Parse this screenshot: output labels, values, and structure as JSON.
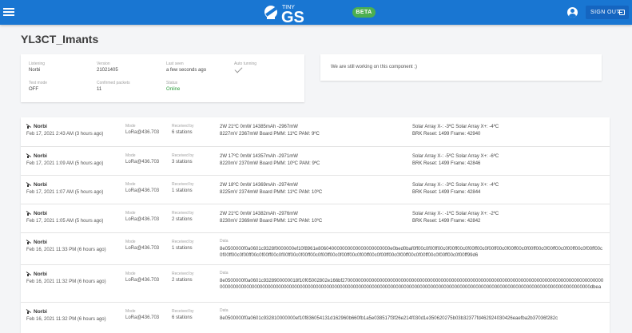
{
  "header": {
    "logo_text_top": "TINY",
    "logo_text_main": "GS",
    "beta": "BETA",
    "signout": "SIGN OUT"
  },
  "station": {
    "name": "YL3CT_Imants",
    "fields": [
      {
        "label": "Listening",
        "value": "Norbi"
      },
      {
        "label": "Version",
        "value": "21021405"
      },
      {
        "label": "Last seen",
        "value": "a few seconds ago"
      },
      {
        "label": "Auto tunning",
        "value": ""
      },
      {
        "label": "Test mode",
        "value": "OFF"
      },
      {
        "label": "Confirmed packets",
        "value": "11"
      },
      {
        "label": "Status",
        "value": "Online"
      }
    ],
    "wip": "We are still working on this component ;)"
  },
  "packets": [
    {
      "sat": "Norbi",
      "date": "Feb 17, 2021 2:43 AM (3 hours ago)",
      "mode": "LoRa@436.703",
      "received": "6 stations",
      "t1": "2W  21ºC  0mW  14385mAh  -2967mW",
      "t2": "8227mV  2367mW  Board PMM: 11ºC PAM: 9ºC",
      "t3": "Solar Array X-: -3ºC Solar Array X+: -4ºC",
      "t4": "BRK Reset: 1499 Frame: 42940"
    },
    {
      "sat": "Norbi",
      "date": "Feb 17, 2021 1:09 AM (5 hours ago)",
      "mode": "LoRa@436.703",
      "received": "3 stations",
      "t1": "2W  17ºC  0mW  14357mAh  -2971mW",
      "t2": "8220mV  2370mW  Board PMM: 10ºC PAM: 9ºC",
      "t3": "Solar Array X-: -5ºC Solar Array X+: -6ºC",
      "t4": "BRK Reset: 1499 Frame: 42846"
    },
    {
      "sat": "Norbi",
      "date": "Feb 17, 2021 1:07 AM (5 hours ago)",
      "mode": "LoRa@436.703",
      "received": "1 stations",
      "t1": "2W  18ºC  0mW  14369mAh  -2974mW",
      "t2": "8225mV  2374mW  Board PMM: 11ºC PAM: 10ºC",
      "t3": "Solar Array X-: -3ºC Solar Array X+: -4ºC",
      "t4": "BRK Reset: 1499 Frame: 42844"
    },
    {
      "sat": "Norbi",
      "date": "Feb 17, 2021 1:05 AM (5 hours ago)",
      "mode": "LoRa@436.703",
      "received": "2 stations",
      "t1": "2W  21ºC  0mW  14382mAh  -2976mW",
      "t2": "8230mV  2369mW  Board PMM: 11ºC PAM: 10ºC",
      "t3": "Solar Array X-: -1ºC Solar Array X+: -2ºC",
      "t4": "BRK Reset: 1499 Frame: 42842"
    },
    {
      "sat": "Norbi",
      "date": "Feb 16, 2021 11:33 PM (6 hours ago)",
      "mode": "LoRa@436.703",
      "received": "1 stations",
      "data": "8e0500000f0a0601c9328f0000000ef10f8961e806040000000000000000000000e0bed0baf0ff00c0f00ff00c0f00ff00c0f00ff00c0f00ff00c0f00ff00c0f00ff00c0f00ff00c0f00ff00c0f00ff00c0f00ff00c0f00ff00c0f00ff00c0f00ff00c0f00ff00c0f00ff00c0f00ff00c0f00ff00c0f00ff00c0f00ff00c0f00ff00c0f00ff00c0f00ff99d6"
    },
    {
      "sat": "Norbi",
      "date": "Feb 16, 2021 11:32 PM (6 hours ago)",
      "mode": "LoRa@436.703",
      "received": "2 stations",
      "data": "8e0500000f0a0601c9328900000018f10f05002802e166bf270000000000000000000000000000000000000000000000000000000000000000000000000000000000000000000000000000000000000000000000000000000000000000000000000000000000000000000000000000000000000000000000000000000000000000000000000000000000000000000dbea"
    },
    {
      "sat": "Norbi",
      "date": "Feb 16, 2021 11:32 PM (6 hours ago)",
      "mode": "LoRa@436.703",
      "received": "6 stations",
      "data": "8e0500000f0a0601c932810000000ef10f836054131d162960b660fb1a5e038517f3f26e214f030d1e350620275b03b32377fd462924030426eaefba2b37036f282c"
    }
  ],
  "labels": {
    "mode": "Mode",
    "received": "Received by",
    "data": "Data"
  },
  "colors": {
    "topbar": "#1976d2",
    "beta": "#4caf50",
    "online": "#2e9c3e"
  }
}
